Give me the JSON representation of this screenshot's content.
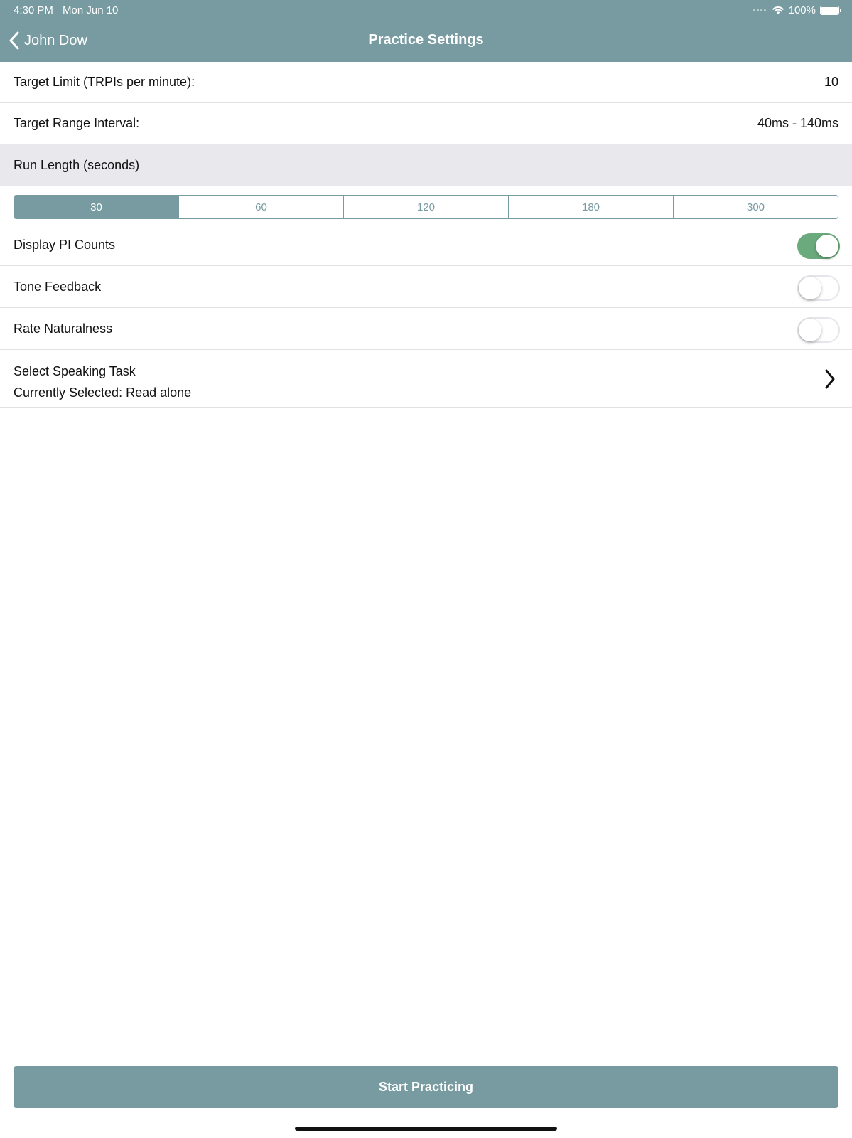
{
  "status_bar": {
    "time": "4:30 PM",
    "date": "Mon Jun 10",
    "battery": "100%",
    "icons": [
      "signal-dots-icon",
      "wifi-icon",
      "battery-icon"
    ]
  },
  "nav": {
    "back_label": "John Dow",
    "title": "Practice Settings",
    "back_icon": "chevron-left-icon"
  },
  "settings": {
    "target_limit": {
      "label": "Target Limit (TRPIs per minute):",
      "value": "10"
    },
    "target_range": {
      "label": "Target Range Interval:",
      "value": "40ms - 140ms"
    },
    "run_length": {
      "label": "Run Length (seconds)",
      "options": [
        "30",
        "60",
        "120",
        "180",
        "300"
      ],
      "selected": "30"
    },
    "display_pi_counts": {
      "label": "Display PI Counts",
      "on": true
    },
    "tone_feedback": {
      "label": "Tone Feedback",
      "on": false
    },
    "rate_naturalness": {
      "label": "Rate Naturalness",
      "on": false
    },
    "speaking_task": {
      "title": "Select Speaking Task",
      "current": "Currently Selected: Read alone",
      "icon": "chevron-right-icon"
    }
  },
  "actions": {
    "start_label": "Start Practicing"
  },
  "colors": {
    "primary": "#789aa1",
    "toggle_on": "#6aaa7c",
    "section_bg": "#e8e8ed"
  }
}
